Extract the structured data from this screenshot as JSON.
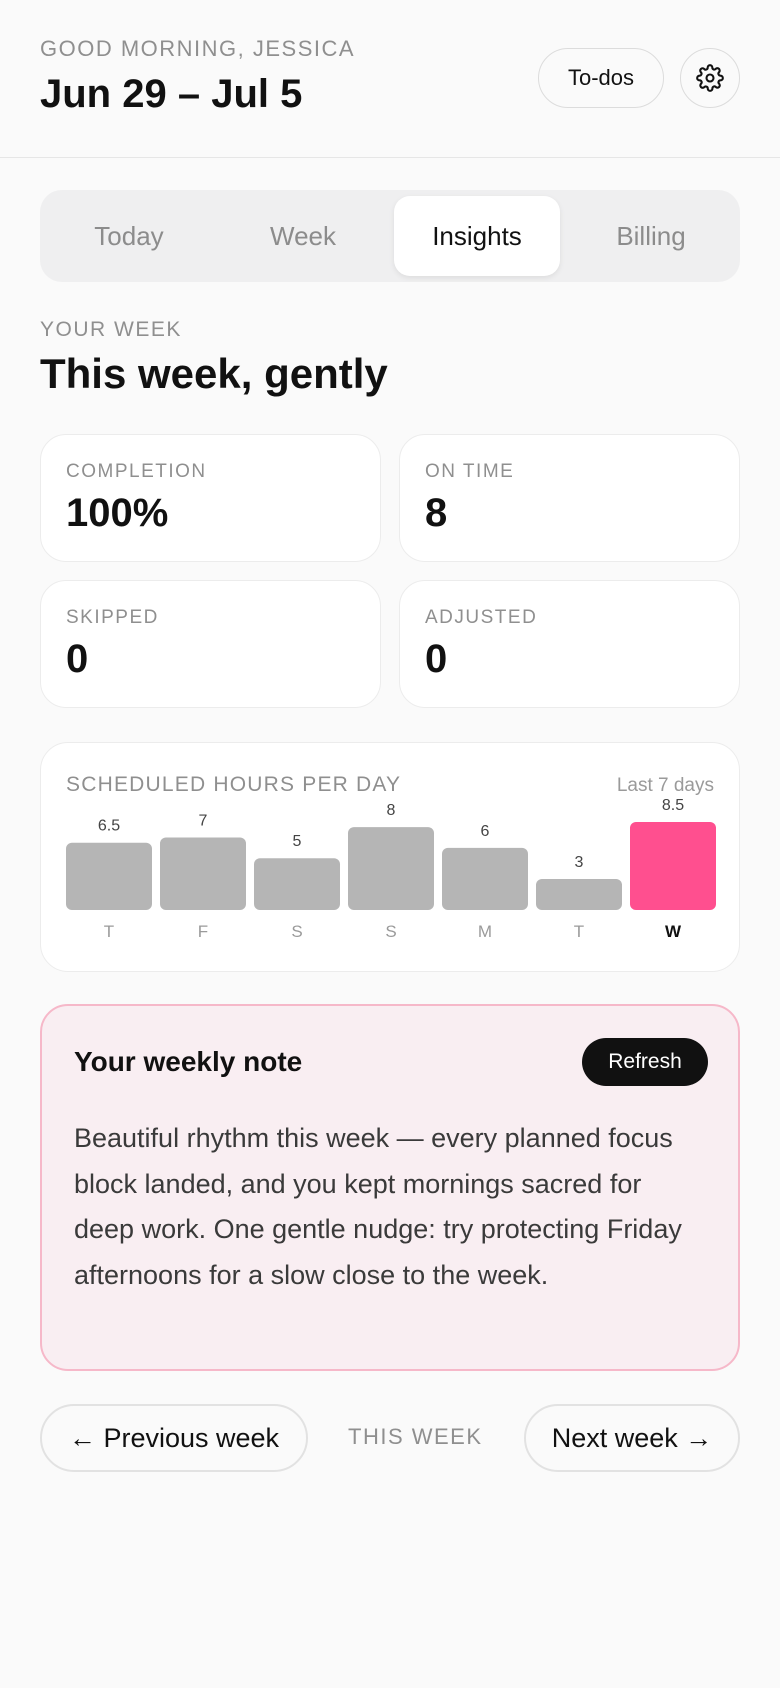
{
  "header": {
    "greeting": "GOOD MORNING, JESSICA",
    "date_range": "Jun 29 – Jul 5",
    "todos_label": "To-dos",
    "settings_icon": "gear-icon"
  },
  "tabs": [
    {
      "label": "Today",
      "active": false
    },
    {
      "label": "Week",
      "active": false
    },
    {
      "label": "Insights",
      "active": true
    },
    {
      "label": "Billing",
      "active": false
    }
  ],
  "section": {
    "kicker": "YOUR WEEK",
    "title": "This week, gently"
  },
  "stats": [
    {
      "label": "COMPLETION",
      "value": "100%"
    },
    {
      "label": "ON TIME",
      "value": "8"
    },
    {
      "label": "SKIPPED",
      "value": "0"
    },
    {
      "label": "ADJUSTED",
      "value": "0"
    }
  ],
  "chart_panel": {
    "title": "SCHEDULED HOURS PER DAY",
    "range_label": "Last 7 days"
  },
  "chart_data": {
    "type": "bar",
    "title": "SCHEDULED HOURS PER DAY",
    "categories": [
      "T",
      "F",
      "S",
      "S",
      "M",
      "T",
      "W"
    ],
    "values": [
      6.5,
      7,
      5,
      8,
      6,
      3,
      8.5
    ],
    "value_labels": [
      "6.5",
      "7",
      "5",
      "8",
      "6",
      "3",
      "8.5"
    ],
    "highlight_index": 6,
    "bar_color": "#b5b5b5",
    "highlight_color": "#ff4f8f",
    "ylim": [
      0,
      8.5
    ]
  },
  "note": {
    "title": "Your weekly note",
    "refresh_label": "Refresh",
    "body": "Beautiful rhythm this week — every planned focus block landed, and you kept mornings sacred for deep work. One gentle nudge: try protecting Friday afternoons for a slow close to the week."
  },
  "week_nav": {
    "prev_label": "← Previous week",
    "current_label": "THIS WEEK",
    "next_label": "Next week →"
  },
  "colors": {
    "accent": "#ff4f8f",
    "note_bg": "#f9eef2",
    "note_border": "#f6b8c9"
  }
}
